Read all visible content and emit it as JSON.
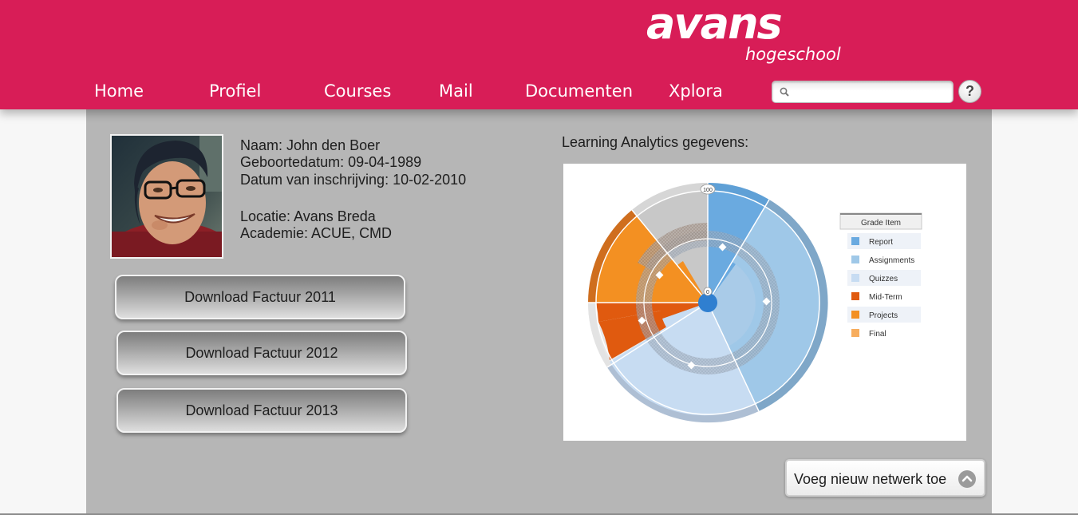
{
  "header": {
    "logo_main": "avans",
    "logo_sub": "hogeschool",
    "brand_color": "#d81d57",
    "nav": [
      "Home",
      "Profiel",
      "Courses",
      "Mail",
      "Documenten",
      "Xplora"
    ],
    "search": {
      "value": "",
      "placeholder": "",
      "icon": "search-icon"
    },
    "help_label": "?"
  },
  "profile": {
    "name_line": "Naam: John den Boer",
    "birth_line": "Geboortedatum: 09-04-1989",
    "enroll_line": "Datum van inschrijving: 10-02-2010",
    "location_line": "Locatie: Avans Breda",
    "academy_line": "Academie: ACUE, CMD"
  },
  "downloads": [
    "Download Factuur 2011",
    "Download Factuur 2012",
    "Download Factuur 2013"
  ],
  "analytics": {
    "title": "Learning Analytics gegevens:",
    "center_label": "0",
    "max_label": "100",
    "legend_title": "Grade Item",
    "legend": [
      {
        "label": "Report",
        "color": "#6aaae0"
      },
      {
        "label": "Assignments",
        "color": "#9fc8e8"
      },
      {
        "label": "Quizzes",
        "color": "#c7dcf2"
      },
      {
        "label": "Mid-Term",
        "color": "#e05a0f"
      },
      {
        "label": "Projects",
        "color": "#f39022"
      },
      {
        "label": "Final",
        "color": "#f7ad5e"
      }
    ]
  },
  "footer_action": {
    "label": "Voeg nieuw netwerk toe",
    "icon": "chevron-up-icon"
  }
}
